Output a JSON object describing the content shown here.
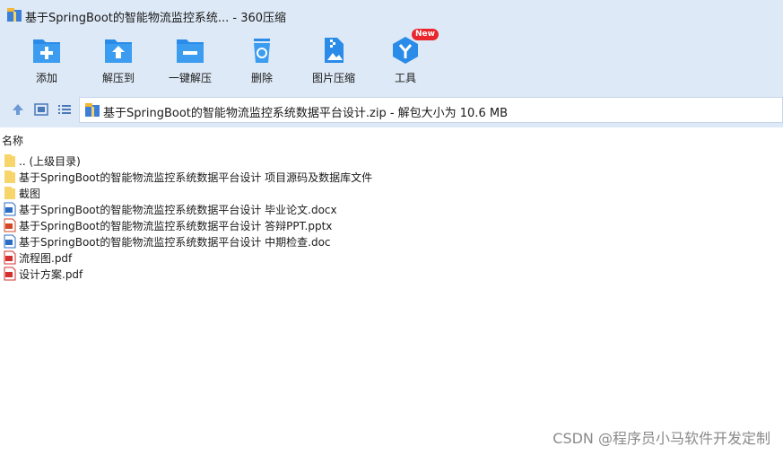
{
  "window": {
    "title": "基于SpringBoot的智能物流监控系统...  -  360压缩"
  },
  "toolbar": {
    "items": [
      {
        "label": "添加",
        "icon": "add-folder-icon"
      },
      {
        "label": "解压到",
        "icon": "extract-to-icon"
      },
      {
        "label": "一键解压",
        "icon": "one-click-extract-icon"
      },
      {
        "label": "删除",
        "icon": "delete-icon"
      },
      {
        "label": "图片压缩",
        "icon": "image-compress-icon"
      },
      {
        "label": "工具",
        "icon": "tools-icon",
        "badge": "New"
      }
    ],
    "colors": {
      "icon_blue": "#2a8be8",
      "badge_red": "#e8262b"
    }
  },
  "address": {
    "path": "基于SpringBoot的智能物流监控系统数据平台设计.zip - 解包大小为 10.6 MB"
  },
  "file_list": {
    "column_header": "名称",
    "rows": [
      {
        "name": ".. (上级目录)",
        "type": "folder"
      },
      {
        "name": "基于SpringBoot的智能物流监控系统数据平台设计 项目源码及数据库文件",
        "type": "folder"
      },
      {
        "name": "截图",
        "type": "folder"
      },
      {
        "name": "基于SpringBoot的智能物流监控系统数据平台设计 毕业论文.docx",
        "type": "word"
      },
      {
        "name": "基于SpringBoot的智能物流监控系统数据平台设计 答辩PPT.pptx",
        "type": "ppt"
      },
      {
        "name": "基于SpringBoot的智能物流监控系统数据平台设计 中期检查.doc",
        "type": "word"
      },
      {
        "name": "流程图.pdf",
        "type": "pdf"
      },
      {
        "name": "设计方案.pdf",
        "type": "pdf"
      }
    ]
  },
  "watermark": "CSDN @程序员小马软件开发定制"
}
